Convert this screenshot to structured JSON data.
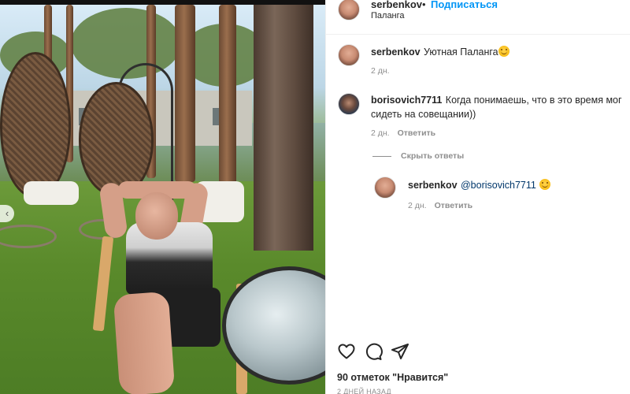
{
  "post": {
    "author": "serbenkov",
    "separator": "•",
    "follow_label": "Подписаться",
    "location": "Паланга"
  },
  "comments": [
    {
      "user": "serbenkov",
      "text": "Уютная Паланга",
      "emoji": "slightly-smiling-face",
      "time": "2 дн."
    },
    {
      "user": "borisovich7711",
      "text": "Когда понимаешь, что в это время мог сидеть на совещании))",
      "time": "2 дн.",
      "reply_label": "Ответить",
      "hide_replies_label": "Скрыть ответы",
      "replies": [
        {
          "user": "serbenkov",
          "text": "@borisovich7711",
          "emoji": "slightly-smiling-face",
          "time": "2 дн.",
          "reply_label": "Ответить"
        }
      ]
    }
  ],
  "actions": {
    "icons": [
      "heart-icon",
      "comment-icon",
      "share-icon"
    ]
  },
  "likes_text": "90 отметок \"Нравится\"",
  "posted_ago": "2 ДНЕЙ НАЗАД",
  "colors": {
    "accent": "#0095f6",
    "secondary_text": "#8e8e8e",
    "primary_text": "#262626"
  }
}
